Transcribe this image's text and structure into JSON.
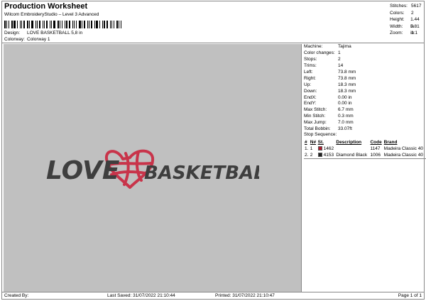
{
  "header": {
    "title": "Production Worksheet",
    "subtitle": "Wilcom EmbroideryStudio – Level 3 Advanced",
    "barcode_char": "("
  },
  "design": {
    "label": "Design:",
    "value": "LOVE BASKETBALL 5,8 in"
  },
  "colorway": {
    "label": "Colorway:",
    "value": "Colorway 1"
  },
  "stats": [
    {
      "k": "Stitches:",
      "v": "5617"
    },
    {
      "k": "Colors:",
      "v": "2"
    },
    {
      "k": "Height:",
      "v": "1.44 in"
    },
    {
      "k": "Width:",
      "v": "5.81 in"
    },
    {
      "k": "Zoom:",
      "v": "1:1"
    }
  ],
  "info": [
    {
      "k": "Machine:",
      "v": "Tajima"
    },
    {
      "k": "Color changes:",
      "v": "1"
    },
    {
      "k": "Stops:",
      "v": "2"
    },
    {
      "k": "Trims:",
      "v": "14"
    },
    {
      "k": "Left:",
      "v": "73.8 mm"
    },
    {
      "k": "Right:",
      "v": "73.8 mm"
    },
    {
      "k": "Up:",
      "v": "18.3 mm"
    },
    {
      "k": "Down:",
      "v": "18.3 mm"
    },
    {
      "k": "EndX:",
      "v": "0.00 in"
    },
    {
      "k": "EndY:",
      "v": "0.00 in"
    },
    {
      "k": "Max Stitch:",
      "v": "6.7 mm"
    },
    {
      "k": "Min Stitch:",
      "v": "0.3 mm"
    },
    {
      "k": "Max Jump:",
      "v": "7.0 mm"
    },
    {
      "k": "Total Bobbin:",
      "v": "33.07ft"
    }
  ],
  "stop_sequence": {
    "label": "Stop Sequence:",
    "headers": [
      "#",
      "N#",
      "",
      "St.",
      "Description",
      "Code",
      "Brand"
    ],
    "rows": [
      {
        "num": "1.",
        "n": "1",
        "color": "#b01c2e",
        "st": "1462",
        "desc": "",
        "code": "1147",
        "brand": "Madeira Classic 40"
      },
      {
        "num": "2.",
        "n": "2",
        "color": "#222222",
        "st": "4153",
        "desc": "Diamond Black",
        "code": "1006",
        "brand": "Madeira Classic 40"
      }
    ]
  },
  "artwork": {
    "text_left": "LOVE",
    "text_right": "BASKETBALL",
    "thread_colors": {
      "black": "#3e3e3e",
      "red": "#c8344a"
    }
  },
  "footer": {
    "created": "Created By:",
    "saved": "Last Saved: 31/07/2022 21:10:44",
    "printed": "Printed: 31/07/2022 21:10:47",
    "page": "Page 1 of 1"
  },
  "colors": {
    "canvas_bg": "#c0c0c0",
    "border": "#888888"
  }
}
